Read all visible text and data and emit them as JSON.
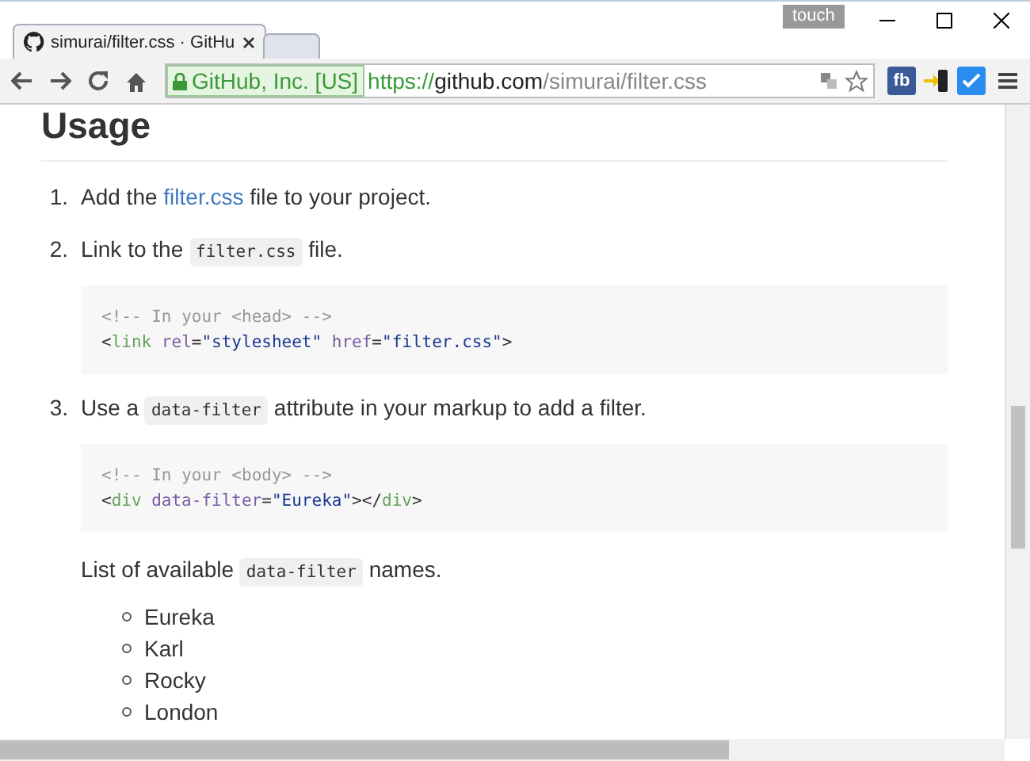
{
  "window": {
    "badge": "touch"
  },
  "tabs": [
    {
      "title": "simurai/filter.css · GitHu",
      "selected": true
    },
    {
      "selected": false
    }
  ],
  "address_bar": {
    "identity": "GitHub, Inc. [US]",
    "scheme": "https://",
    "host": "github.com",
    "path": "/simurai/filter.css"
  },
  "extensions": [
    {
      "kind": "fb",
      "label": "fb"
    },
    {
      "kind": "phone"
    },
    {
      "kind": "check"
    }
  ],
  "content": {
    "heading": "Usage",
    "steps": [
      {
        "marker": "1.",
        "parts": [
          {
            "kind": "text",
            "text": "Add the "
          },
          {
            "kind": "link",
            "text": "filter.css"
          },
          {
            "kind": "text",
            "text": " file to your project."
          }
        ]
      },
      {
        "marker": "2.",
        "parts": [
          {
            "kind": "text",
            "text": "Link to the "
          },
          {
            "kind": "code",
            "text": "filter.css"
          },
          {
            "kind": "text",
            "text": " file."
          }
        ],
        "code": [
          [
            {
              "kind": "comment",
              "text": "<!-- In your <head> -->"
            }
          ],
          [
            {
              "kind": "punct",
              "text": "<"
            },
            {
              "kind": "tag",
              "text": "link"
            },
            {
              "kind": "attr",
              "text": "rel",
              "space_before": true
            },
            {
              "kind": "punct",
              "text": "="
            },
            {
              "kind": "string",
              "text": "\"stylesheet\""
            },
            {
              "kind": "attr",
              "text": "href",
              "space_before": true
            },
            {
              "kind": "punct",
              "text": "="
            },
            {
              "kind": "string",
              "text": "\"filter.css\""
            },
            {
              "kind": "punct",
              "text": ">"
            }
          ]
        ]
      },
      {
        "marker": "3.",
        "parts": [
          {
            "kind": "text",
            "text": "Use a "
          },
          {
            "kind": "code",
            "text": "data-filter"
          },
          {
            "kind": "text",
            "text": " attribute in your markup to add a filter."
          }
        ],
        "code": [
          [
            {
              "kind": "comment",
              "text": "<!-- In your <body> -->"
            }
          ],
          [
            {
              "kind": "punct",
              "text": "<"
            },
            {
              "kind": "tag",
              "text": "div"
            },
            {
              "kind": "attr",
              "text": "data-filter",
              "space_before": true
            },
            {
              "kind": "punct",
              "text": "="
            },
            {
              "kind": "string",
              "text": "\"Eureka\""
            },
            {
              "kind": "punct",
              "text": "></"
            },
            {
              "kind": "tag",
              "text": "div"
            },
            {
              "kind": "punct",
              "text": ">"
            }
          ]
        ],
        "note": [
          {
            "kind": "text",
            "text": "List of available "
          },
          {
            "kind": "code",
            "text": "data-filter"
          },
          {
            "kind": "text",
            "text": " names."
          }
        ],
        "names": [
          "Eureka",
          "Karl",
          "Rocky",
          "London"
        ]
      }
    ]
  }
}
